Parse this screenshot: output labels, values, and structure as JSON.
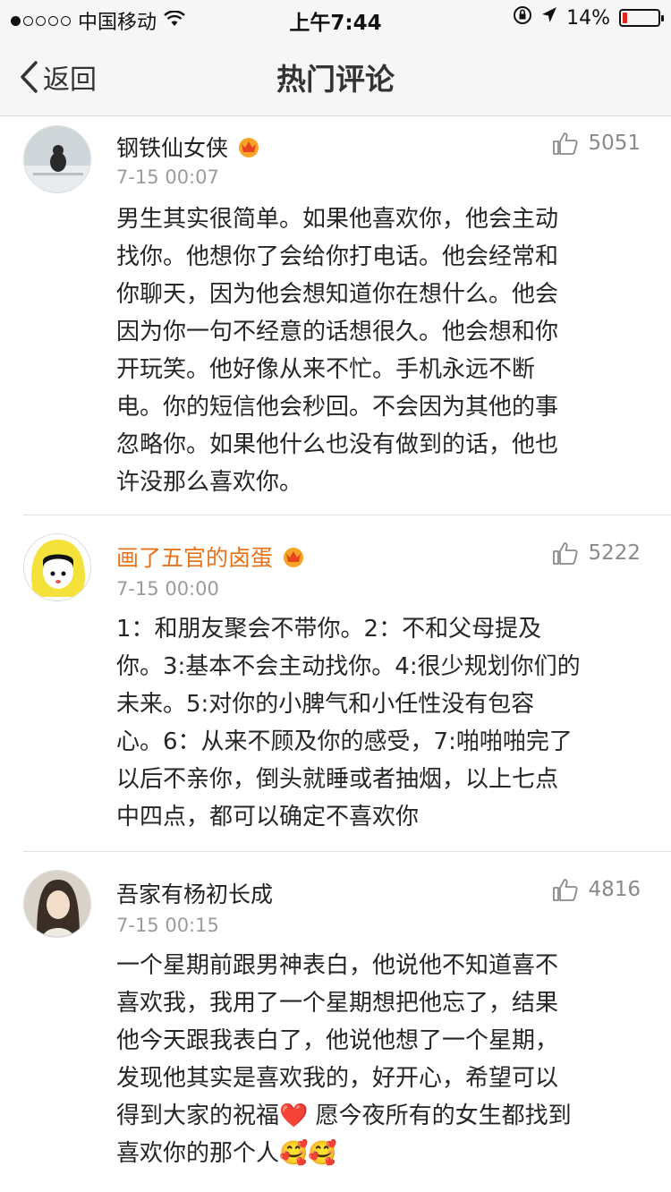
{
  "status_bar": {
    "carrier": "中国移动",
    "time": "上午7:44",
    "battery_percent": "14%",
    "battery_level": 0.14,
    "signal_icon": "signal-dots-icon",
    "wifi_icon": "wifi-icon",
    "lock_icon": "orientation-lock-icon",
    "location_icon": "location-arrow-icon",
    "battery_color": "#e0261f"
  },
  "nav": {
    "back_label": "返回",
    "title": "热门评论"
  },
  "comments": [
    {
      "username": "钢铁仙女侠",
      "username_color": "#222222",
      "badge_icon": "crown-badge-icon",
      "time": "7-15 00:07",
      "likes": "5051",
      "lines": [
        "男生其实很简单。如果他喜欢你，他会主动",
        "找你。他想你了会给你打电话。他会经常和",
        "你聊天，因为他会想知道你在想什么。他会",
        "因为你一句不经意的话想很久。他会想和你",
        "开玩笑。他好像从来不忙。手机永远不断",
        "电。你的短信他会秒回。不会因为其他的事",
        "忽略你。如果他什么也没有做到的话，他也",
        "许没那么喜欢你。"
      ]
    },
    {
      "username": "画了五官的卤蛋",
      "username_color": "#e8731a",
      "badge_icon": "crown-badge-icon",
      "time": "7-15 00:00",
      "likes": "5222",
      "lines": [
        "1：和朋友聚会不带你。2：不和父母提及",
        "你。3:基本不会主动找你。4:很少规划你们的",
        "未来。5:对你的小脾气和小任性没有包容",
        "心。6：从来不顾及你的感受，7:啪啪啪完了",
        "以后不亲你，倒头就睡或者抽烟，以上七点",
        "中四点，都可以确定不喜欢你"
      ]
    },
    {
      "username": "吾家有杨初长成",
      "username_color": "#222222",
      "time": "7-15 00:15",
      "likes": "4816",
      "lines": [
        "一个星期前跟男神表白，他说他不知道喜不",
        "喜欢我，我用了一个星期想把他忘了，结果",
        "他今天跟我表白了，他说他想了一个星期，",
        "发现他其实是喜欢我的，好开心，希望可以",
        "得到大家的祝福❤️ 愿今夜所有的女生都找到",
        "喜欢你的那个人🥰🥰"
      ]
    }
  ]
}
